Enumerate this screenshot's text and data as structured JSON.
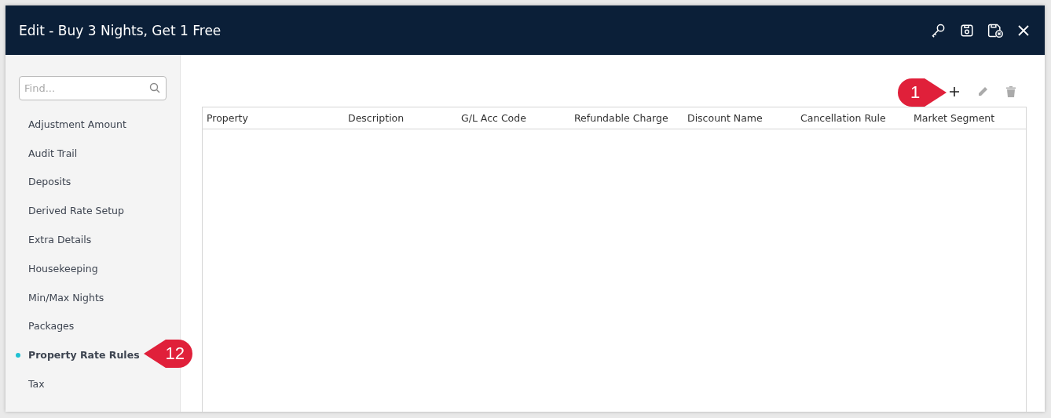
{
  "window": {
    "title": "Edit - Buy 3 Nights, Get 1 Free"
  },
  "sidebar": {
    "search": {
      "placeholder": "Find..."
    },
    "items": [
      {
        "label": "Adjustment Amount",
        "selected": false
      },
      {
        "label": "Audit Trail",
        "selected": false
      },
      {
        "label": "Deposits",
        "selected": false
      },
      {
        "label": "Derived Rate Setup",
        "selected": false
      },
      {
        "label": "Extra Details",
        "selected": false
      },
      {
        "label": "Housekeeping",
        "selected": false
      },
      {
        "label": "Min/Max Nights",
        "selected": false
      },
      {
        "label": "Packages",
        "selected": false
      },
      {
        "label": "Property Rate Rules",
        "selected": true
      },
      {
        "label": "Tax",
        "selected": false
      }
    ]
  },
  "table": {
    "columns": [
      "Property",
      "Description",
      "G/L Acc Code",
      "Refundable Charge",
      "Discount Name",
      "Cancellation Rule",
      "Market Segment"
    ]
  },
  "callouts": [
    {
      "label": "1",
      "kind": "right"
    },
    {
      "label": "12",
      "kind": "left"
    }
  ]
}
